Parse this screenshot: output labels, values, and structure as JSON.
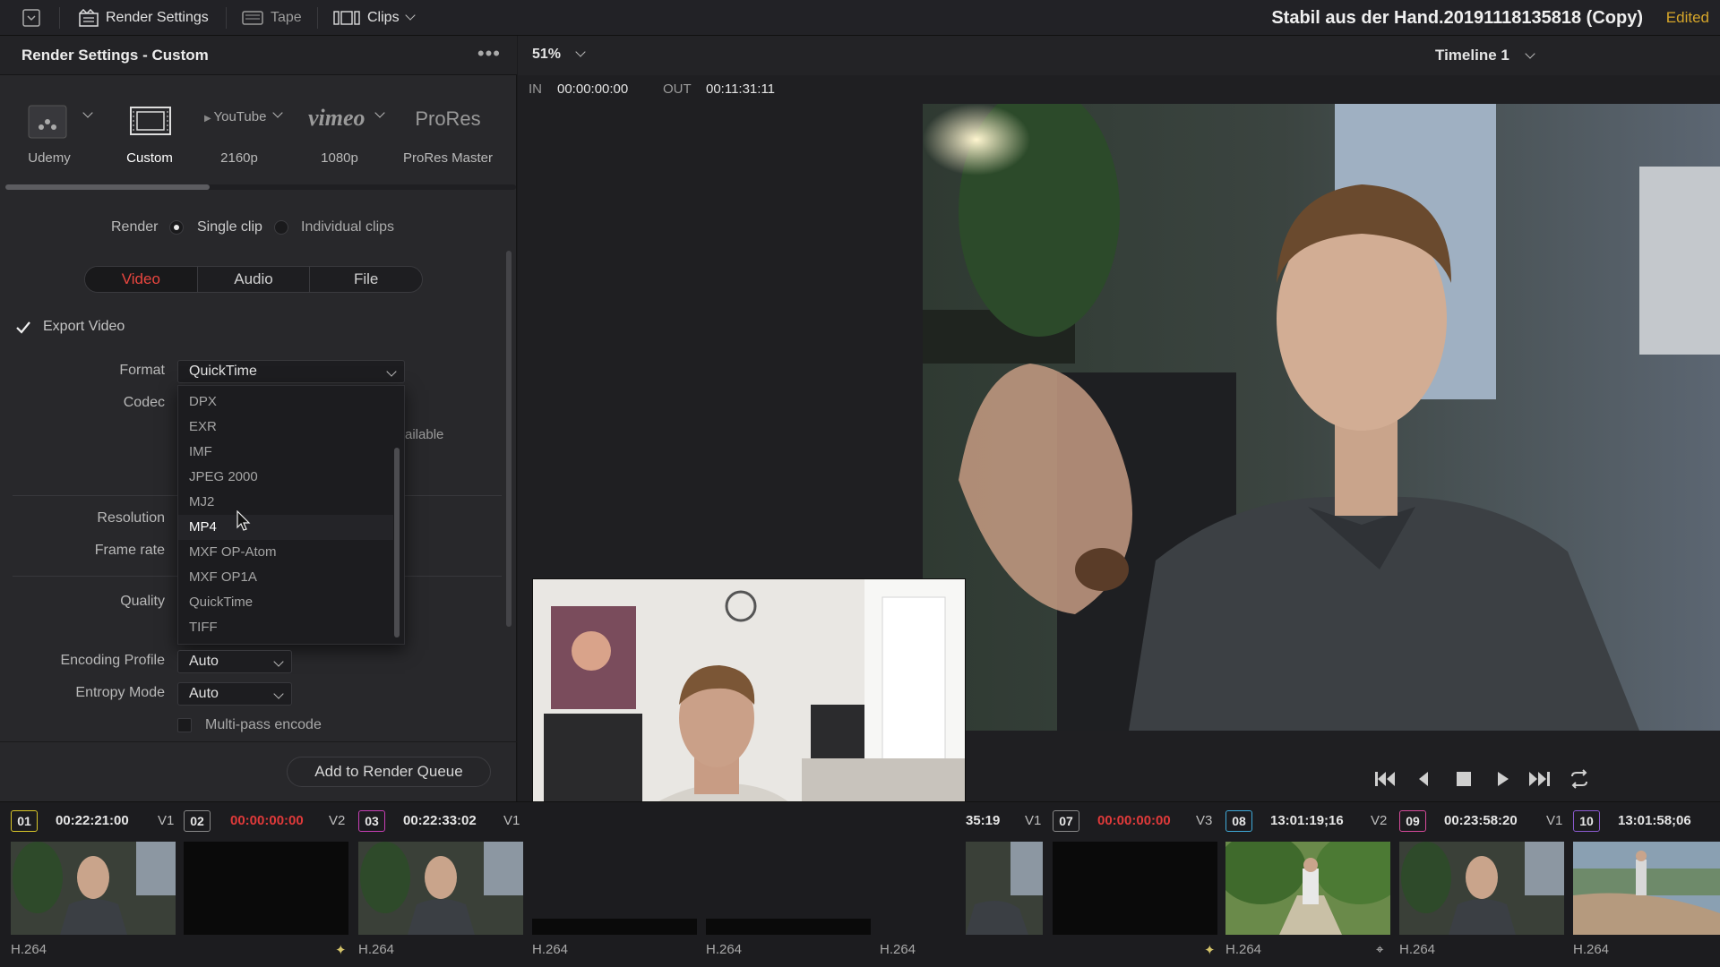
{
  "topbar": {
    "render_settings": "Render Settings",
    "tape": "Tape",
    "clips": "Clips",
    "project_title": "Stabil aus der Hand.20191118135818 (Copy)",
    "edited": "Edited"
  },
  "panel": {
    "title": "Render Settings - Custom",
    "more": "•••",
    "presets": [
      {
        "top": "",
        "label": "Udemy"
      },
      {
        "top": "",
        "label": "Custom"
      },
      {
        "top": "YouTube",
        "label": "2160p"
      },
      {
        "top": "vimeo",
        "label": "1080p"
      },
      {
        "top": "ProRes",
        "label": "ProRes Master"
      }
    ],
    "render_label": "Render",
    "single_clip": "Single clip",
    "individual_clips": "Individual clips",
    "tabs": [
      "Video",
      "Audio",
      "File"
    ],
    "export_video": "Export Video",
    "format_label": "Format",
    "format_value": "QuickTime",
    "codec_label": "Codec",
    "partial_text": "ailable",
    "resolution_label": "Resolution",
    "frame_rate_label": "Frame rate",
    "quality_label": "Quality",
    "format_options": [
      "DPX",
      "EXR",
      "IMF",
      "JPEG 2000",
      "MJ2",
      "MP4",
      "MXF OP-Atom",
      "MXF OP1A",
      "QuickTime",
      "TIFF"
    ],
    "hovered_option": "MP4",
    "encoding_profile_label": "Encoding Profile",
    "encoding_profile_value": "Auto",
    "entropy_mode_label": "Entropy Mode",
    "entropy_mode_value": "Auto",
    "multipass": "Multi-pass encode",
    "add_to_queue": "Add to Render Queue"
  },
  "viewer": {
    "zoom": "51%",
    "timeline": "Timeline 1",
    "in_label": "IN",
    "in_tc": "00:00:00:00",
    "out_label": "OUT",
    "out_tc": "00:11:31:11"
  },
  "clips": [
    {
      "num": "01",
      "tc": "00:22:21:00",
      "track": "V1",
      "codec": "H.264",
      "red": false
    },
    {
      "num": "02",
      "tc": "00:00:00:00",
      "track": "V2",
      "codec": "",
      "red": true
    },
    {
      "num": "03",
      "tc": "00:22:33:02",
      "track": "V1",
      "codec": "H.264",
      "red": false
    },
    {
      "num": "",
      "tc": "",
      "track": "",
      "codec": "H.264",
      "red": false
    },
    {
      "num": "",
      "tc": "",
      "track": "",
      "codec": "H.264",
      "red": false
    },
    {
      "num": "",
      "tc": "35:19",
      "track": "V1",
      "codec": "H.264",
      "red": false
    },
    {
      "num": "07",
      "tc": "00:00:00:00",
      "track": "V3",
      "codec": "",
      "red": true
    },
    {
      "num": "08",
      "tc": "13:01:19;16",
      "track": "V2",
      "codec": "H.264",
      "red": false
    },
    {
      "num": "09",
      "tc": "00:23:58:20",
      "track": "V1",
      "codec": "H.264",
      "red": false
    },
    {
      "num": "10",
      "tc": "13:01:58;06",
      "track": "",
      "codec": "H.264",
      "red": false
    }
  ],
  "colors": {
    "accent_red": "#e8463f",
    "edited_yellow": "#d6a62a",
    "clip_num_01": "#d9c728",
    "clip_num_03": "#c83fb5",
    "clip_num_08": "#3fa9d8",
    "clip_num_09": "#d64a9a",
    "clip_num_10": "#8b5ad0"
  },
  "icons": [
    "render-settings-icon",
    "tape-icon",
    "clips-icon",
    "dropdown-icon",
    "skip-back-icon",
    "step-back-icon",
    "stop-icon",
    "play-icon",
    "skip-forward-icon",
    "loop-icon"
  ]
}
